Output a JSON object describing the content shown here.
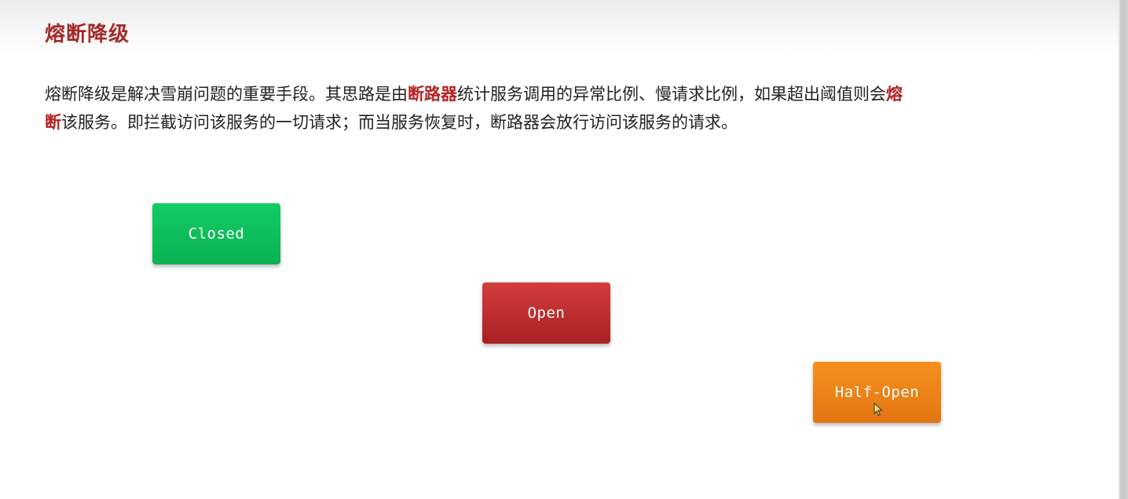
{
  "slide": {
    "title": "熔断降级",
    "paragraph": {
      "line1": [
        {
          "text": "熔断降级是解决雪崩问题的重要手段。其思路是由",
          "highlight": false
        },
        {
          "text": "断路器",
          "highlight": true
        },
        {
          "text": "统计服务调用的异常比例、慢请求比例，如果超出阈值则会",
          "highlight": false
        },
        {
          "text": "熔",
          "highlight": true
        }
      ],
      "line2": [
        {
          "text": "断",
          "highlight": true
        },
        {
          "text": "该服务。即拦截访问该服务的一切请求；而当服务恢复时，断路器会放行访问该服务的请求。",
          "highlight": false
        }
      ]
    },
    "states": {
      "closed": "Closed",
      "open": "Open",
      "half_open": "Half-Open"
    }
  },
  "colors": {
    "title": "#a52a2a",
    "highlight": "#b42222",
    "closed": "#0bb152",
    "open": "#b82a2e",
    "half_open": "#ef8418"
  }
}
